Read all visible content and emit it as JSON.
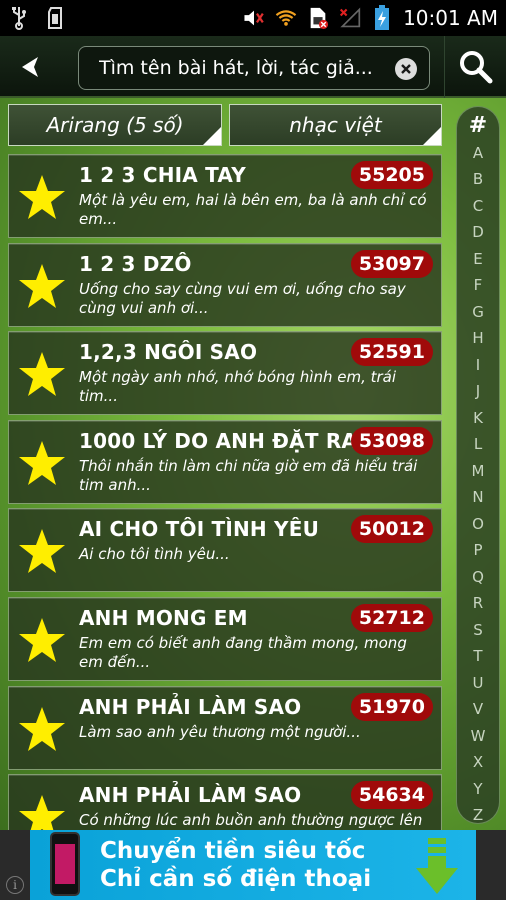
{
  "status_bar": {
    "time": "10:01 AM",
    "icons": [
      "usb-icon",
      "sd-card-icon",
      "mute-icon",
      "wifi-icon",
      "sim-error-icon",
      "no-signal-icon",
      "battery-charging-icon"
    ]
  },
  "header": {
    "back_icon": "back-arrow-icon",
    "search_placeholder": "Tìm tên bài hát, lời, tác giả...",
    "clear_icon": "clear-icon",
    "search_icon": "search-icon"
  },
  "filters": {
    "songbook": "Arirang (5 số)",
    "genre": "nhạc việt"
  },
  "songs": [
    {
      "title": "1 2 3 CHIA TAY",
      "code": "55205",
      "lyric": "Một là yêu em, hai là bên em, ba là anh chỉ có em..."
    },
    {
      "title": "1 2 3 DZÔ",
      "code": "53097",
      "lyric": "Uống cho say cùng vui em ơi, uống cho say cùng vui anh ơi..."
    },
    {
      "title": "1,2,3 NGÔI SAO",
      "code": "52591",
      "lyric": "Một ngày anh nhớ, nhớ bóng hình em, trái tim..."
    },
    {
      "title": "1000 LÝ DO ANH ĐẶT RA",
      "code": "53098",
      "lyric": "Thôi nhắn tin làm chi nữa giờ em đã hiểu trái tim anh..."
    },
    {
      "title": "AI CHO TÔI TÌNH YÊU",
      "code": "50012",
      "lyric": "Ai cho tôi tình yêu..."
    },
    {
      "title": "ANH MONG EM",
      "code": "52712",
      "lyric": "Em em có biết anh đang thầm mong, mong em đến..."
    },
    {
      "title": "ANH PHẢI LÀM SAO",
      "code": "51970",
      "lyric": "Làm sao anh yêu thương một người..."
    },
    {
      "title": "ANH PHẢI LÀM SAO",
      "code": "54634",
      "lyric": "Có những lúc anh buồn anh thường ngược lên trời"
    }
  ],
  "alphabet": [
    "#",
    "A",
    "B",
    "C",
    "D",
    "E",
    "F",
    "G",
    "H",
    "I",
    "J",
    "K",
    "L",
    "M",
    "N",
    "O",
    "P",
    "Q",
    "R",
    "S",
    "T",
    "U",
    "V",
    "W",
    "X",
    "Y",
    "Z"
  ],
  "ad": {
    "line1": "Chuyển tiền siêu tốc",
    "line2": "Chỉ cần số điện thoại",
    "info_label": "i"
  },
  "colors": {
    "code_badge": "#a00a0a",
    "star": "#ffee00",
    "ad_background": "#0aa2d8",
    "ad_arrow": "#6bbf2a"
  }
}
